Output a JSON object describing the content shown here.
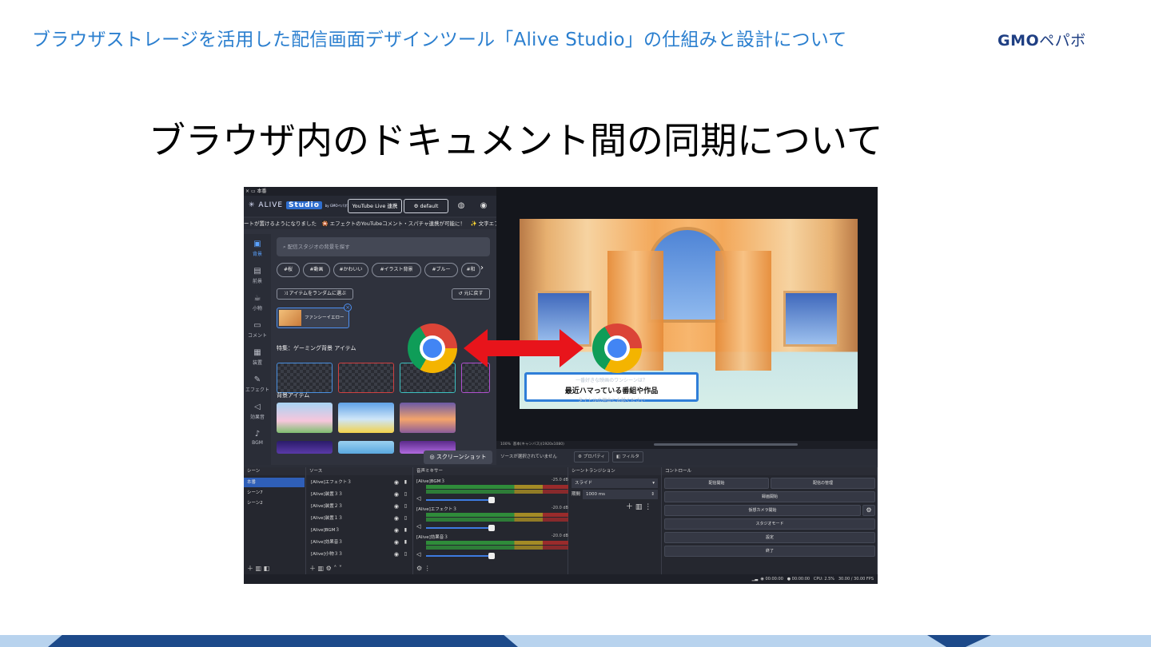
{
  "header": {
    "title": "ブラウザストレージを活用した配信画面デザインツール「Alive Studio」の仕組みと設計について",
    "logo_gmo": "GMO",
    "logo_pepabo": "ペパボ"
  },
  "slide": {
    "title": "ブラウザ内のドキュメント間の同期について"
  },
  "colors": {
    "header_blue": "#2b7fcf",
    "arrow_red": "#e8141b",
    "band_light": "#b8d3ee",
    "band_dark": "#1d4a8a"
  },
  "app": {
    "window_tab": "本番",
    "brand": "ALIVE",
    "brand_studio": "Studio",
    "brand_by": "by GMOペパボ",
    "youtube_button": "YouTube Live 連携",
    "default_button": "default",
    "ticker": "ートが置けるようになりました　🎇 エフェクトのYouTubeコメント・スパチャ連携が可能に！　✨ 文字エフ",
    "nav": [
      {
        "icon": "image-icon",
        "label": "背景"
      },
      {
        "icon": "layers-icon",
        "label": "前景"
      },
      {
        "icon": "cup-icon",
        "label": "小物"
      },
      {
        "icon": "comment-icon",
        "label": "コメント"
      },
      {
        "icon": "grid-icon",
        "label": "装置"
      },
      {
        "icon": "brush-icon",
        "label": "エフェクト"
      },
      {
        "icon": "speaker-icon",
        "label": "効果音"
      },
      {
        "icon": "music-icon",
        "label": "BGM"
      }
    ],
    "search_placeholder": "配信スタジオの背景を探す",
    "chips": [
      "#桜",
      "#動画",
      "#かわいい",
      "#イラスト背景",
      "#ブルー",
      "#和"
    ],
    "random_button": "アイテムをランダムに選ぶ",
    "undo_button": "元に戻す",
    "selected_item": "ファンシーイエロー",
    "feature_label": "特集：ゲーミング背景 アイテム",
    "bg_items_label": "背景アイテム",
    "screenshot_button": "スクリーンショット"
  },
  "preview": {
    "caption_faint_top": "一番好きな映画のワンシーンは？",
    "caption_main": "最近ハマっている番組や作品",
    "caption_faint_bottom": "タイトルの理由とお話ください",
    "status_zoom": "100%",
    "status_canvas": "基本(キャンバス)(1920x1080)",
    "no_source": "ソースが選択されていません",
    "properties": "プロパティ",
    "filters": "フィルタ"
  },
  "obs": {
    "scenes_title": "シーン",
    "scenes": [
      "本番",
      "シーン7",
      "シーン2"
    ],
    "sources_title": "ソース",
    "sources": [
      "[Alive]エフェクト３",
      "[Alive]装置３３",
      "[Alive]装置２３",
      "[Alive]装置１３",
      "[Alive]BGM３",
      "[Alive]効果音３",
      "[Alive]小物３３"
    ],
    "mixer_title": "音声ミキサー",
    "mixer": [
      {
        "name": "[Alive]BGM３",
        "db": "-25.0 dB"
      },
      {
        "name": "[Alive]エフェクト３",
        "db": "-20.0 dB"
      },
      {
        "name": "[Alive]効果音３",
        "db": "-20.0 dB"
      }
    ],
    "transition_title": "シーントランジション",
    "transition_type": "スライド",
    "duration_label": "期間",
    "duration_value": "1000 ms",
    "controls_title": "コントロール",
    "controls": {
      "start_stream": "配信開始",
      "manage_stream": "配信の管理",
      "start_record": "録画開始",
      "virtual_camera": "仮想カメラ開始",
      "studio_mode": "スタジオモード",
      "settings": "設定",
      "exit": "終了"
    },
    "status": {
      "time1": "00:00:00",
      "time2": "00:00:00",
      "cpu": "CPU: 2.5%",
      "fps": "30.00 / 30.00 FPS"
    }
  }
}
